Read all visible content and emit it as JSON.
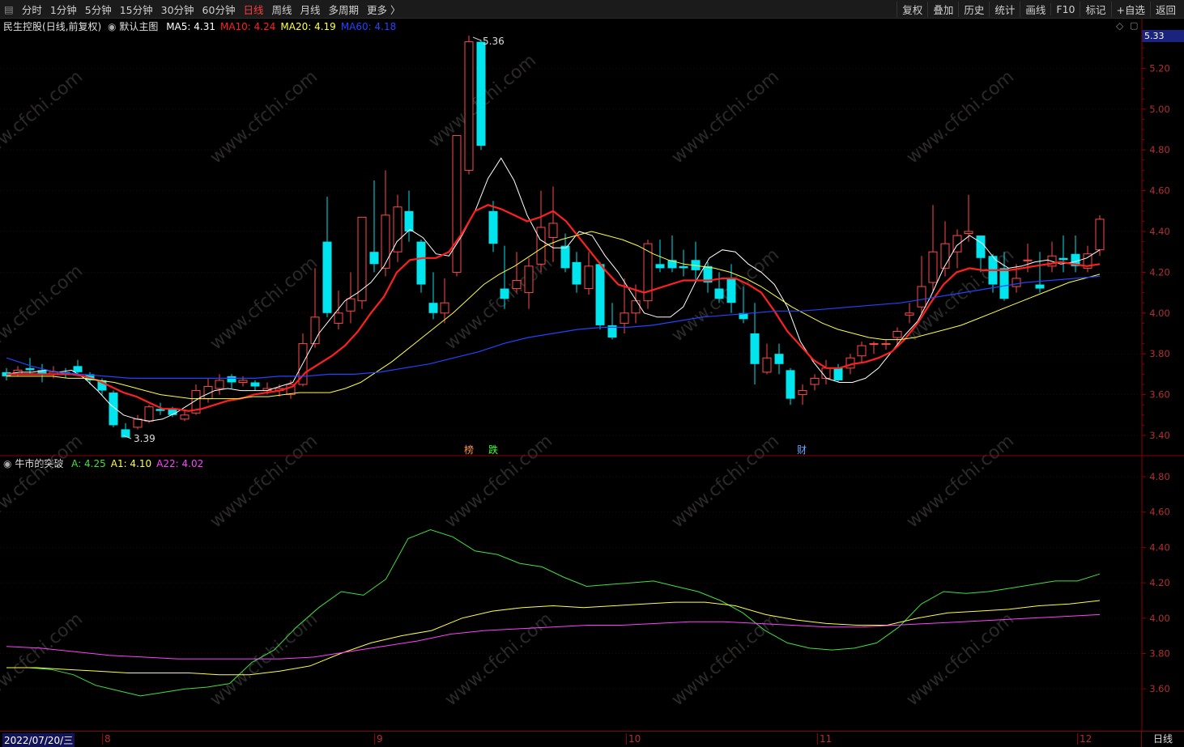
{
  "toolbar": {
    "periods": [
      "分时",
      "1分钟",
      "5分钟",
      "15分钟",
      "30分钟",
      "60分钟",
      "日线",
      "周线",
      "月线",
      "多周期",
      "更多 〉"
    ],
    "active_period": "日线",
    "right_buttons": [
      "复权",
      "叠加",
      "历史",
      "统计",
      "画线",
      "F10",
      "标记",
      "+自选",
      "返回"
    ]
  },
  "main_panel": {
    "stock_name": "民生控股",
    "mode": "(日线,前复权)",
    "template": "默认主图",
    "ma": [
      {
        "label": "MA5: 4.31",
        "color": "#ffffff"
      },
      {
        "label": "MA10: 4.24",
        "color": "#ff2020"
      },
      {
        "label": "MA20: 4.19",
        "color": "#ffff40"
      },
      {
        "label": "MA60: 4.18",
        "color": "#2244ff"
      }
    ],
    "current_price": "5.33",
    "high_label": "5.36",
    "low_label": "3.39",
    "markers": [
      {
        "text": "榜",
        "color": "#ff9040"
      },
      {
        "text": "跌",
        "color": "#40ff40"
      },
      {
        "text": "财",
        "color": "#66aaff"
      }
    ],
    "y_ticks": [
      "5.20",
      "5.00",
      "4.80",
      "4.60",
      "4.40",
      "4.20",
      "4.00",
      "3.80",
      "3.60",
      "3.40"
    ]
  },
  "indicator_panel": {
    "name": "牛市的突破",
    "values": [
      {
        "label": "A: 4.25",
        "color": "#40e040"
      },
      {
        "label": "A1: 4.10",
        "color": "#ffff40"
      },
      {
        "label": "A22: 4.02",
        "color": "#ff40ff"
      }
    ],
    "y_ticks": [
      "4.80",
      "4.60",
      "4.40",
      "4.20",
      "4.00",
      "3.80",
      "3.60"
    ]
  },
  "x_axis": {
    "start_date": "2022/07/20/三",
    "month_ticks": [
      "8",
      "9",
      "10",
      "11",
      "12"
    ],
    "period_label": "日线"
  },
  "watermark": "www.cfchi.com",
  "chart_data": [
    {
      "type": "line",
      "title": "",
      "series": [
        {
          "name": "MA5",
          "color": "#ffffff",
          "values": [
            3.7,
            3.71,
            3.71,
            3.72,
            3.71,
            3.72,
            3.68,
            3.62,
            3.55,
            3.5,
            3.48,
            3.47,
            3.48,
            3.51,
            3.55,
            3.59,
            3.62,
            3.63,
            3.62,
            3.62,
            3.62,
            3.64,
            3.66,
            3.78,
            3.9,
            3.98,
            4.06,
            4.1,
            4.15,
            4.23,
            4.35,
            4.41,
            4.37,
            4.29,
            4.28,
            4.38,
            4.5,
            4.66,
            4.76,
            4.65,
            4.48,
            4.36,
            4.32,
            4.32,
            4.4,
            4.38,
            4.28,
            4.2,
            4.1,
            4.0,
            3.98,
            3.98,
            4.03,
            4.16,
            4.27,
            4.31,
            4.3,
            4.24,
            4.2,
            4.14,
            4.03,
            3.86,
            3.76,
            3.68,
            3.66,
            3.66,
            3.68,
            3.73,
            3.81,
            3.89,
            3.96,
            4.08,
            4.22,
            4.33,
            4.38,
            4.34,
            4.26,
            4.22,
            4.23,
            4.25,
            4.26,
            4.24,
            4.25,
            4.27,
            4.31
          ]
        },
        {
          "name": "MA10",
          "color": "#ff2020",
          "values": [
            3.7,
            3.7,
            3.7,
            3.7,
            3.7,
            3.7,
            3.69,
            3.67,
            3.64,
            3.61,
            3.59,
            3.56,
            3.53,
            3.53,
            3.52,
            3.53,
            3.55,
            3.57,
            3.58,
            3.6,
            3.61,
            3.62,
            3.64,
            3.71,
            3.75,
            3.79,
            3.84,
            3.91,
            4.0,
            4.08,
            4.2,
            4.26,
            4.27,
            4.27,
            4.3,
            4.39,
            4.5,
            4.53,
            4.51,
            4.48,
            4.45,
            4.47,
            4.5,
            4.45,
            4.37,
            4.29,
            4.21,
            4.14,
            4.12,
            4.1,
            4.12,
            4.14,
            4.16,
            4.16,
            4.16,
            4.17,
            4.17,
            4.14,
            4.1,
            4.01,
            3.91,
            3.84,
            3.77,
            3.73,
            3.73,
            3.75,
            3.76,
            3.78,
            3.81,
            3.87,
            3.95,
            4.05,
            4.14,
            4.2,
            4.22,
            4.21,
            4.21,
            4.21,
            4.22,
            4.23,
            4.24,
            4.25,
            4.24,
            4.23,
            4.24
          ]
        },
        {
          "name": "MA20",
          "color": "#ffff40",
          "values": [
            3.69,
            3.69,
            3.69,
            3.69,
            3.68,
            3.68,
            3.67,
            3.66,
            3.64,
            3.62,
            3.6,
            3.59,
            3.58,
            3.58,
            3.58,
            3.58,
            3.59,
            3.59,
            3.6,
            3.61,
            3.61,
            3.61,
            3.63,
            3.66,
            3.71,
            3.76,
            3.82,
            3.88,
            3.94,
            4.0,
            4.07,
            4.14,
            4.19,
            4.23,
            4.28,
            4.33,
            4.36,
            4.38,
            4.4,
            4.38,
            4.36,
            4.33,
            4.29,
            4.26,
            4.24,
            4.23,
            4.22,
            4.2,
            4.17,
            4.13,
            4.08,
            4.03,
            3.99,
            3.95,
            3.92,
            3.9,
            3.88,
            3.87,
            3.87,
            3.88,
            3.9,
            3.92,
            3.94,
            3.97,
            4.0,
            4.03,
            4.06,
            4.09,
            4.12,
            4.15,
            4.17,
            4.19
          ]
        },
        {
          "name": "MA60",
          "color": "#2244ff",
          "values": [
            3.78,
            3.74,
            3.71,
            3.7,
            3.69,
            3.68,
            3.68,
            3.68,
            3.68,
            3.68,
            3.68,
            3.69,
            3.69,
            3.7,
            3.7,
            3.71,
            3.73,
            3.75,
            3.78,
            3.81,
            3.85,
            3.88,
            3.9,
            3.92,
            3.93,
            3.93,
            3.94,
            3.96,
            3.98,
            3.99,
            4.0,
            4.01,
            4.01,
            4.02,
            4.03,
            4.04,
            4.05,
            4.07,
            4.09,
            4.11,
            4.13,
            4.15,
            4.16,
            4.17,
            4.18
          ]
        }
      ]
    },
    {
      "type": "line",
      "title": "",
      "ylim": [
        3.5,
        4.9
      ],
      "series": [
        {
          "name": "A",
          "color": "#40e040",
          "values": [
            3.72,
            3.72,
            3.71,
            3.68,
            3.62,
            3.59,
            3.56,
            3.58,
            3.6,
            3.61,
            3.63,
            3.75,
            3.82,
            3.95,
            4.06,
            4.15,
            4.13,
            4.22,
            4.45,
            4.5,
            4.46,
            4.38,
            4.36,
            4.31,
            4.29,
            4.23,
            4.18,
            4.19,
            4.2,
            4.21,
            4.18,
            4.15,
            4.1,
            4.03,
            3.93,
            3.86,
            3.83,
            3.82,
            3.83,
            3.86,
            3.95,
            4.08,
            4.15,
            4.14,
            4.15,
            4.17,
            4.19,
            4.21,
            4.21,
            4.25
          ]
        },
        {
          "name": "A1",
          "color": "#ffff40",
          "values": [
            3.72,
            3.72,
            3.71,
            3.7,
            3.69,
            3.69,
            3.69,
            3.68,
            3.68,
            3.7,
            3.73,
            3.8,
            3.86,
            3.9,
            3.93,
            4.0,
            4.04,
            4.06,
            4.07,
            4.06,
            4.07,
            4.08,
            4.09,
            4.09,
            4.07,
            4.02,
            3.99,
            3.97,
            3.96,
            3.96,
            4.0,
            4.03,
            4.04,
            4.05,
            4.07,
            4.08,
            4.1
          ]
        },
        {
          "name": "A22",
          "color": "#ff40ff",
          "values": [
            3.84,
            3.83,
            3.81,
            3.79,
            3.78,
            3.77,
            3.77,
            3.77,
            3.77,
            3.78,
            3.81,
            3.84,
            3.87,
            3.91,
            3.93,
            3.94,
            3.95,
            3.96,
            3.96,
            3.97,
            3.98,
            3.98,
            3.97,
            3.96,
            3.95,
            3.95,
            3.96,
            3.97,
            3.98,
            3.99,
            4.0,
            4.01,
            4.02
          ]
        }
      ]
    }
  ]
}
